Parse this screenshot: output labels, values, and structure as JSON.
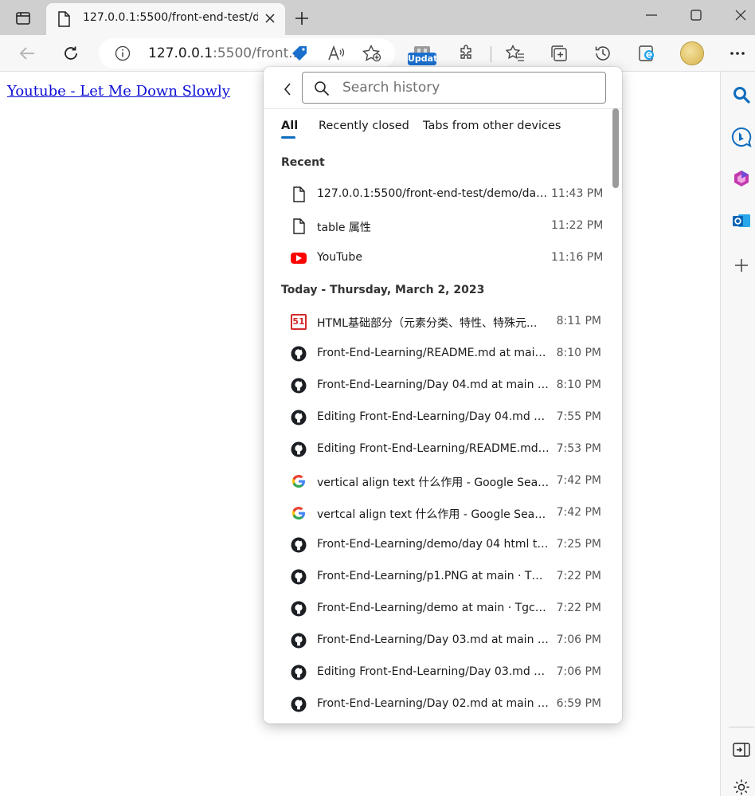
{
  "browser": {
    "tab": {
      "title": "127.0.0.1:5500/front-end-test/de"
    },
    "address": {
      "host": "127.0.0.1",
      "rest": ":5500/front..."
    },
    "update_badge": "Updat"
  },
  "page": {
    "link_text": "Youtube - Let Me Down Slowly"
  },
  "history": {
    "search_placeholder": "Search history",
    "tabs": [
      {
        "label": "All",
        "active": true
      },
      {
        "label": "Recently closed",
        "active": false
      },
      {
        "label": "Tabs from other devices",
        "active": false
      }
    ],
    "sections": [
      {
        "header": "Recent",
        "items": [
          {
            "icon": "page-icon",
            "title": "127.0.0.1:5500/front-end-test/demo/day 3...",
            "time": "11:43 PM"
          },
          {
            "icon": "page-icon",
            "title": "table 属性",
            "time": "11:22 PM"
          },
          {
            "icon": "youtube-icon",
            "title": "YouTube",
            "time": "11:16 PM"
          }
        ]
      },
      {
        "header": "Today - Thursday, March 2, 2023",
        "items": [
          {
            "icon": "site-51cto-icon",
            "title": "HTML基础部分（元素分类、特性、特殊元...",
            "time": "8:11 PM"
          },
          {
            "icon": "github-icon",
            "title": "Front-End-Learning/README.md at main · ...",
            "time": "8:10 PM"
          },
          {
            "icon": "github-icon",
            "title": "Front-End-Learning/Day 04.md at main · Tg...",
            "time": "8:10 PM"
          },
          {
            "icon": "github-icon",
            "title": "Editing Front-End-Learning/Day 04.md at ...",
            "time": "7:55 PM"
          },
          {
            "icon": "github-icon",
            "title": "Editing Front-End-Learning/README.md at...",
            "time": "7:53 PM"
          },
          {
            "icon": "google-icon",
            "title": "vertical align text 什么作用 - Google Search",
            "time": "7:42 PM"
          },
          {
            "icon": "google-icon",
            "title": "vertcal align text 什么作用 - Google Search",
            "time": "7:42 PM"
          },
          {
            "icon": "github-icon",
            "title": "Front-End-Learning/demo/day 04 html tabl...",
            "time": "7:25 PM"
          },
          {
            "icon": "github-icon",
            "title": "Front-End-Learning/p1.PNG at main · Tgc0...",
            "time": "7:22 PM"
          },
          {
            "icon": "github-icon",
            "title": "Front-End-Learning/demo at main · Tgc020...",
            "time": "7:22 PM"
          },
          {
            "icon": "github-icon",
            "title": "Front-End-Learning/Day 03.md at main · Tg...",
            "time": "7:06 PM"
          },
          {
            "icon": "github-icon",
            "title": "Editing Front-End-Learning/Day 03.md at ...",
            "time": "7:06 PM"
          },
          {
            "icon": "github-icon",
            "title": "Front-End-Learning/Day 02.md at main · Tg...",
            "time": "6:59 PM"
          }
        ]
      }
    ]
  },
  "colors": {
    "accent": "#0f6cbd",
    "link": "#0b0bd6",
    "youtube": "#ff0000"
  }
}
